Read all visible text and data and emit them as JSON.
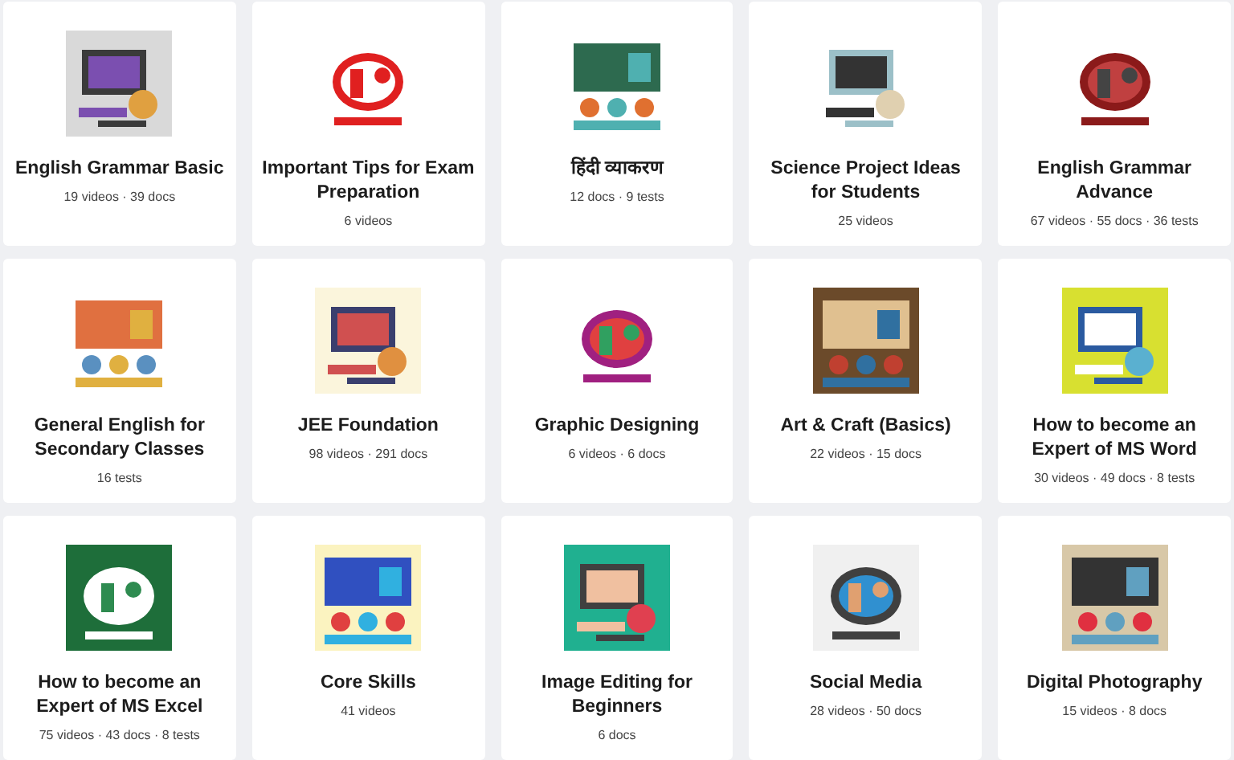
{
  "courses": [
    {
      "title": "English Grammar Basic",
      "meta": "19 videos · 39 docs"
    },
    {
      "title": "Important Tips for Exam Preparation",
      "meta": "6 videos"
    },
    {
      "title": "हिंदी व्याकरण",
      "meta": "12 docs · 9 tests"
    },
    {
      "title": "Science Project Ideas for Students",
      "meta": "25 videos"
    },
    {
      "title": "English Grammar Advance",
      "meta": "67 videos · 55 docs · 36 tests"
    },
    {
      "title": "General English for Secondary Classes",
      "meta": "16 tests"
    },
    {
      "title": "JEE Foundation",
      "meta": "98 videos · 291 docs"
    },
    {
      "title": "Graphic Designing",
      "meta": "6 videos · 6 docs"
    },
    {
      "title": "Art & Craft (Basics)",
      "meta": "22 videos · 15 docs"
    },
    {
      "title": "How to become an Expert of MS Word",
      "meta": "30 videos · 49 docs · 8 tests"
    },
    {
      "title": "How to become an Expert of MS Excel",
      "meta": "75 videos · 43 docs · 8 tests"
    },
    {
      "title": "Core Skills",
      "meta": "41 videos"
    },
    {
      "title": "Image Editing for Beginners",
      "meta": "6 docs"
    },
    {
      "title": "Social Media",
      "meta": "28 videos · 50 docs"
    },
    {
      "title": "Digital Photography",
      "meta": "15 videos · 8 docs"
    }
  ]
}
